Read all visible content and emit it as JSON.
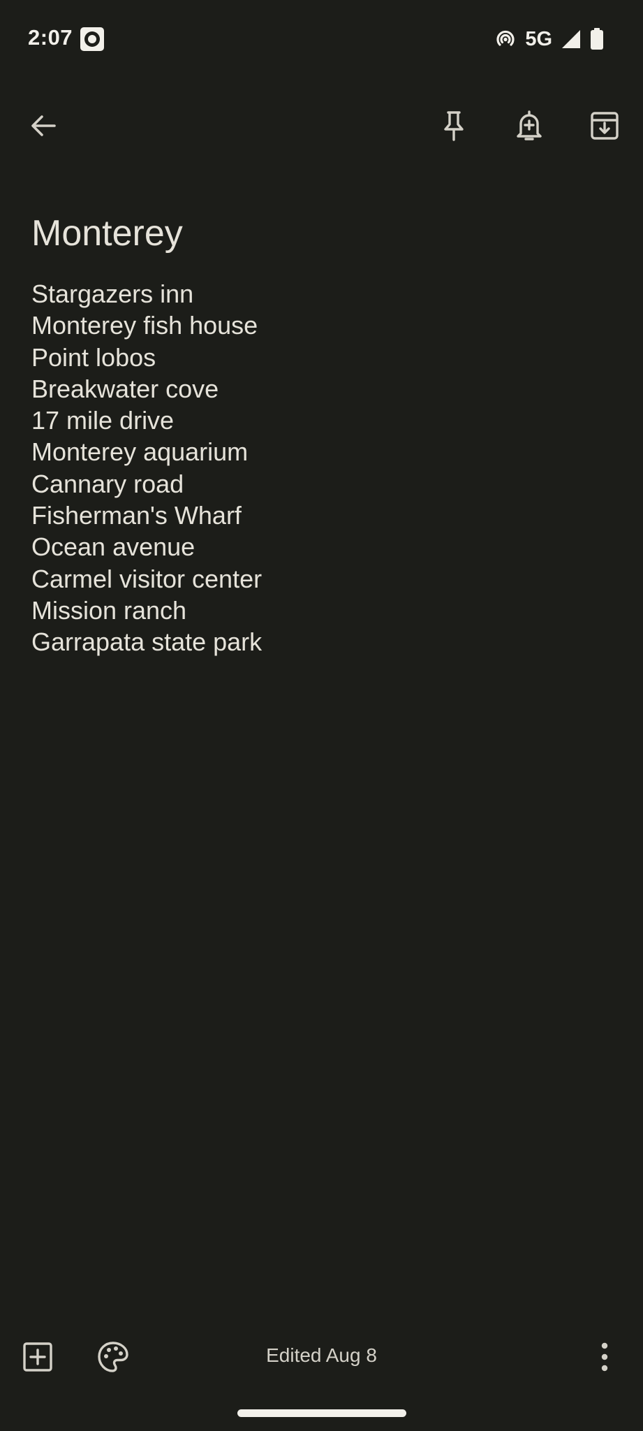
{
  "status_bar": {
    "time": "2:07",
    "network": "5G"
  },
  "toolbar": {
    "back_icon": "arrow-left-icon",
    "pin_icon": "pin-icon",
    "reminder_icon": "bell-plus-icon",
    "archive_icon": "archive-icon"
  },
  "note": {
    "title": "Monterey",
    "lines": [
      "Stargazers inn",
      "Monterey fish house",
      "Point lobos",
      "Breakwater cove",
      "17 mile drive",
      "Monterey aquarium",
      "Cannary road",
      "Fisherman's Wharf",
      "Ocean avenue",
      "Carmel visitor center",
      "Mission ranch",
      "Garrapata state park"
    ]
  },
  "bottom_bar": {
    "edited_label": "Edited Aug 8"
  },
  "colors": {
    "background": "#1c1d19",
    "text": "#e6e3da",
    "icon": "#d4d1c8"
  }
}
